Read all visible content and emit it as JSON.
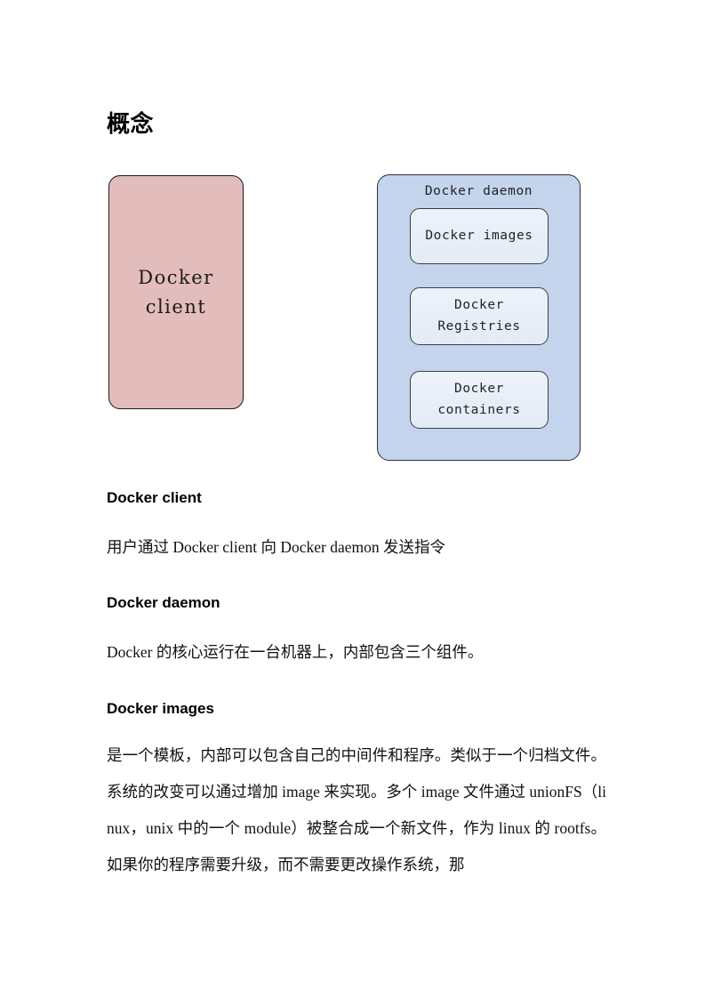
{
  "document": {
    "title": "概念"
  },
  "diagram": {
    "client_box": {
      "label": "Docker\nclient",
      "fill_color": "#E3BDBC",
      "border_color": "#1A1A1A"
    },
    "daemon_box": {
      "title": "Docker daemon",
      "fill_color": "#C4D4ED",
      "border_color": "#2C3038",
      "items": [
        {
          "label": "Docker images",
          "fill_color": "#EDF2FA"
        },
        {
          "label": "Docker\nRegistries",
          "fill_color": "#EDF2FA"
        },
        {
          "label": "Docker\ncontainers",
          "fill_color": "#EDF2FA"
        }
      ]
    }
  },
  "sections": [
    {
      "heading": "Docker client",
      "body": "用户通过 Docker client 向 Docker daemon 发送指令"
    },
    {
      "heading": "Docker daemon",
      "body": "Docker 的核心运行在一台机器上，内部包含三个组件。"
    },
    {
      "heading": "Docker images",
      "body": "是一个模板，内部可以包含自己的中间件和程序。类似于一个归档文件。系统的改变可以通过增加 image 来实现。多个 image 文件通过 unionFS（linux，unix 中的一个 module）被整合成一个新文件，作为 linux 的 rootfs。如果你的程序需要升级，而不需要更改操作系统，那"
    }
  ]
}
